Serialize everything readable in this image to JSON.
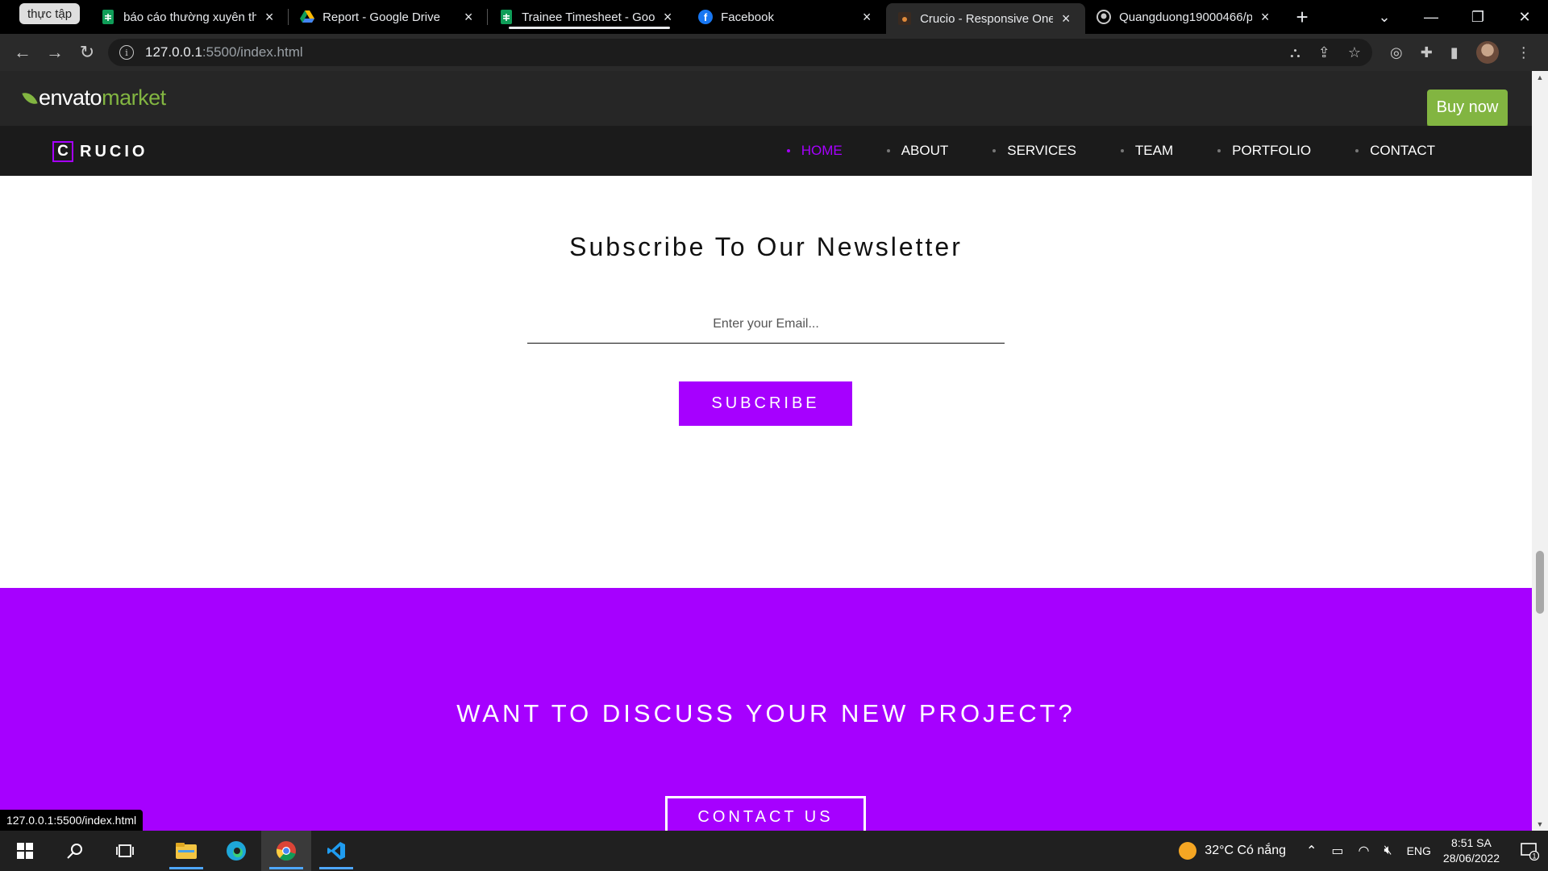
{
  "browser": {
    "tab_group_label": "thực tập",
    "tabs": [
      {
        "title": "báo cáo thường xuyên th",
        "favicon": "sheets-icon",
        "active": false
      },
      {
        "title": "Report - Google Drive",
        "favicon": "drive-icon",
        "active": false
      },
      {
        "title": "Trainee Timesheet - Goo",
        "favicon": "sheets-icon",
        "active": false
      },
      {
        "title": "Facebook",
        "favicon": "facebook-icon",
        "active": false
      },
      {
        "title": "Crucio - Responsive One",
        "favicon": "crucio-icon",
        "active": true
      },
      {
        "title": "Quangduong19000466/p",
        "favicon": "github-icon",
        "active": false
      }
    ],
    "address_host": "127.0.0.1",
    "address_path": ":5500/index.html",
    "status_url": "127.0.0.1:5500/index.html"
  },
  "envato": {
    "brand": "envato",
    "market": "market",
    "buy_now": "Buy now"
  },
  "site": {
    "logo_mark": "C",
    "logo_text": "RUCIO",
    "menu": [
      {
        "label": "HOME",
        "active": true
      },
      {
        "label": "ABOUT",
        "active": false
      },
      {
        "label": "SERVICES",
        "active": false
      },
      {
        "label": "TEAM",
        "active": false
      },
      {
        "label": "PORTFOLIO",
        "active": false
      },
      {
        "label": "CONTACT",
        "active": false
      }
    ],
    "accent_color": "#a600ff"
  },
  "newsletter": {
    "title": "Subscribe To Our Newsletter",
    "email_placeholder": "Enter your Email...",
    "button": "SUBCRIBE"
  },
  "cta": {
    "title": "WANT TO DISCUSS YOUR NEW PROJECT?",
    "button": "CONTACT US"
  },
  "taskbar": {
    "weather": "32°C  Có nắng",
    "lang": "ENG",
    "time": "8:51 SA",
    "date": "28/06/2022",
    "notifications": "1"
  }
}
